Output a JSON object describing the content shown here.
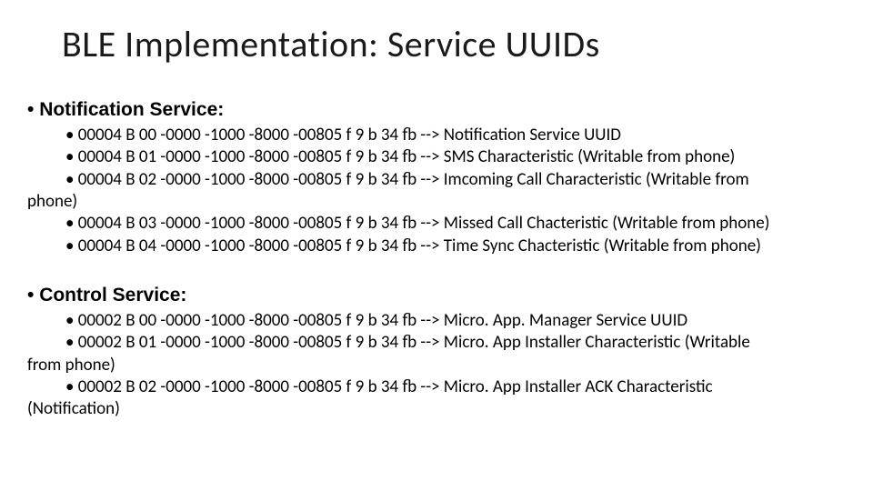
{
  "title": "BLE Implementation: Service UUIDs",
  "sections": [
    {
      "heading": "Notification Service:",
      "items": [
        "00004 B 00 -0000 -1000 -8000 -00805 f 9 b 34 fb --> Notification Service UUID",
        "00004 B 01 -0000 -1000 -8000 -00805 f 9 b 34 fb --> SMS Characteristic (Writable from phone)",
        "00004 B 02 -0000 -1000 -8000 -00805 f 9 b 34 fb --> Imcoming Call Characteristic (Writable from",
        "00004 B 03 -0000 -1000 -8000 -00805 f 9 b 34 fb --> Missed Call Chacteristic (Writable from phone)",
        "00004 B 04 -0000 -1000 -8000 -00805 f 9 b 34 fb --> Time Sync Chacteristic (Writable from phone)"
      ],
      "wrap_after_index": 2,
      "wrap_tail": "phone)"
    },
    {
      "heading": "Control Service:",
      "items": [
        "00002 B 00 -0000 -1000 -8000 -00805 f 9 b 34 fb --> Micro. App. Manager Service UUID",
        "00002 B 01 -0000 -1000 -8000 -00805 f 9 b 34 fb --> Micro. App Installer Characteristic (Writable",
        "00002 B 02 -0000 -1000 -8000 -00805 f 9 b 34 fb --> Micro. App Installer ACK Characteristic"
      ],
      "wrap_after_index": 1,
      "wrap_tail": "from phone)",
      "wrap_after_index_2": 2,
      "wrap_tail_2": "(Notification)"
    }
  ]
}
